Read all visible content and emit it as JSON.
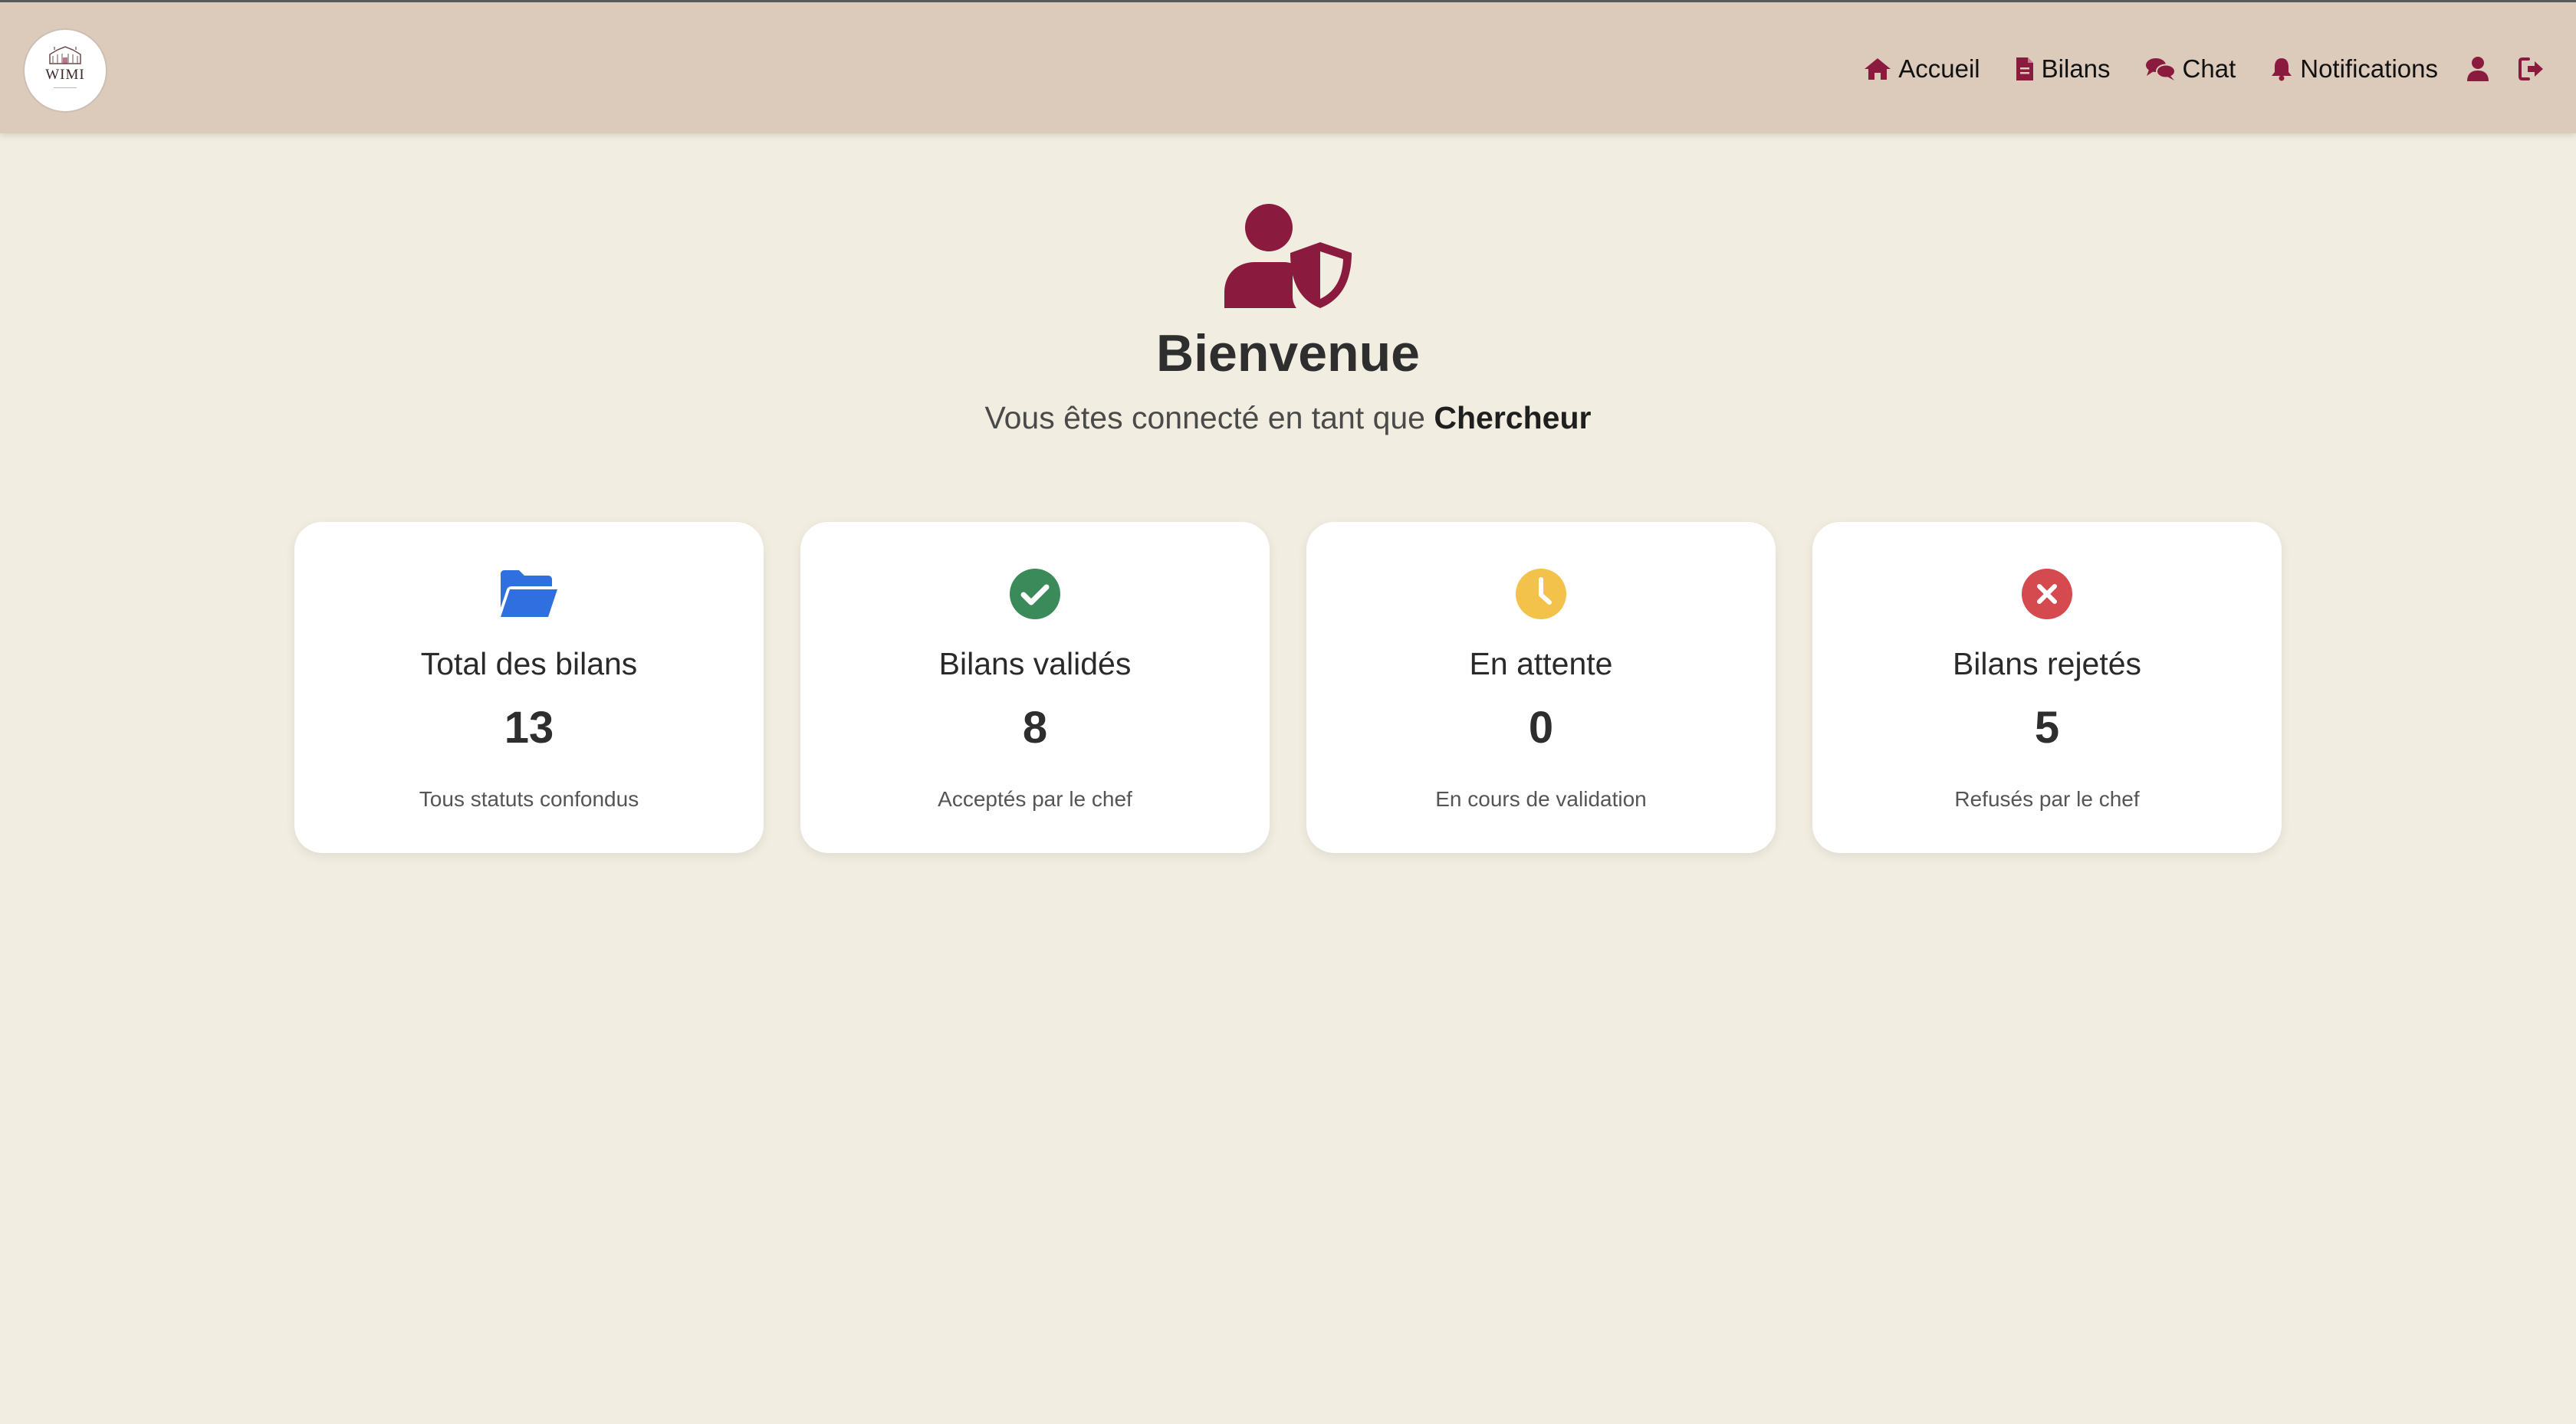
{
  "colors": {
    "brand": "#8a1b3f",
    "navbar_bg": "#dccbbb",
    "page_bg": "#f2ede1",
    "total_icon": "#2f6fe0",
    "validated_icon": "#3a8a5a",
    "pending_icon": "#f3c24b",
    "rejected_icon": "#d44a4f"
  },
  "logo": {
    "name": "WIMI"
  },
  "nav": {
    "items": [
      {
        "label": "Accueil",
        "icon": "home-icon"
      },
      {
        "label": "Bilans",
        "icon": "document-icon"
      },
      {
        "label": "Chat",
        "icon": "chat-icon"
      },
      {
        "label": "Notifications",
        "icon": "bell-icon"
      }
    ],
    "profile_icon": "user-icon",
    "logout_icon": "logout-icon"
  },
  "hero": {
    "icon": "user-shield-icon",
    "title": "Bienvenue",
    "subtitle_prefix": "Vous êtes connecté en tant que",
    "role": "Chercheur"
  },
  "stats": [
    {
      "icon": "folder-open-icon",
      "title": "Total des bilans",
      "value": "13",
      "description": "Tous statuts confondus"
    },
    {
      "icon": "check-circle-icon",
      "title": "Bilans validés",
      "value": "8",
      "description": "Acceptés par le chef"
    },
    {
      "icon": "clock-icon",
      "title": "En attente",
      "value": "0",
      "description": "En cours de validation"
    },
    {
      "icon": "x-circle-icon",
      "title": "Bilans rejetés",
      "value": "5",
      "description": "Refusés par le chef"
    }
  ]
}
